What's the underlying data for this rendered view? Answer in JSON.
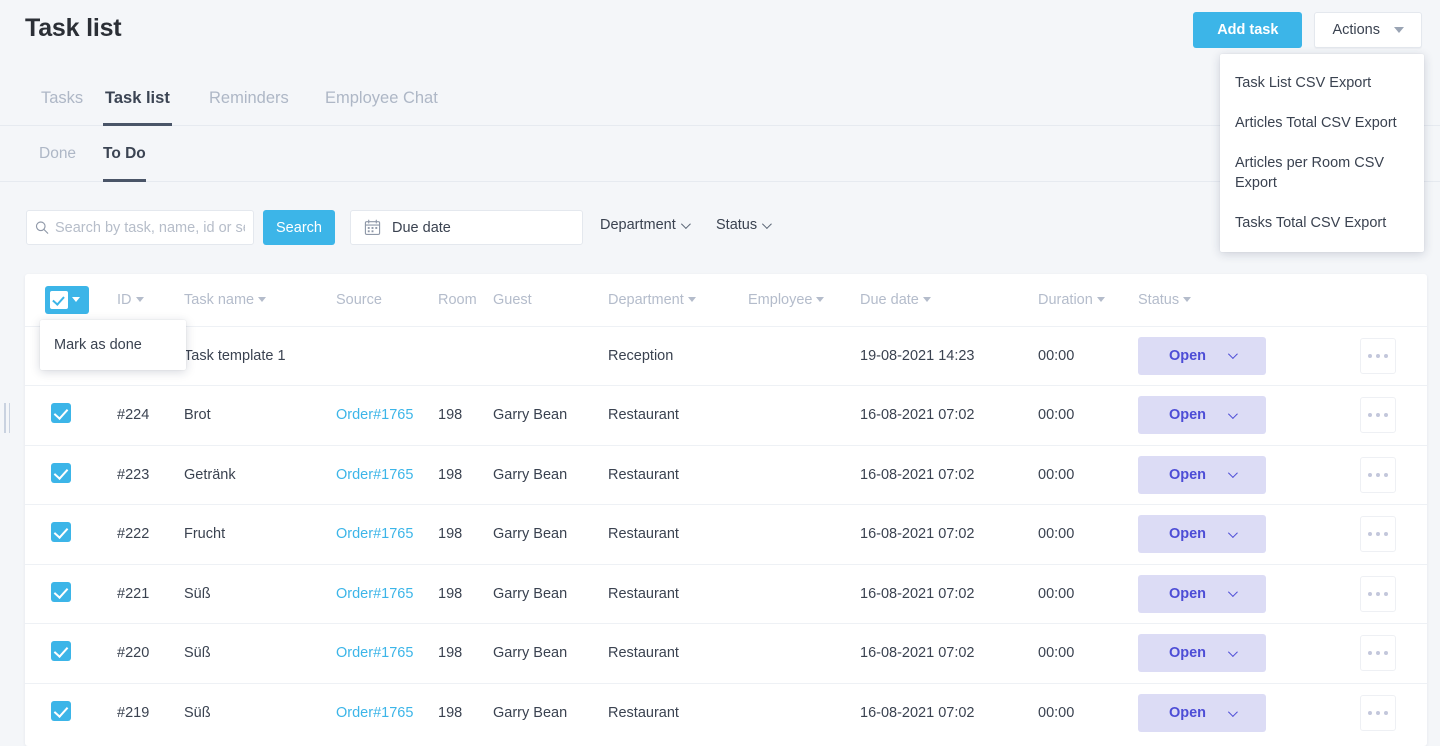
{
  "header": {
    "title": "Task list",
    "add_task_label": "Add task",
    "actions_label": "Actions"
  },
  "actions_menu": {
    "items": [
      {
        "label": "Task List CSV Export"
      },
      {
        "label": "Articles Total CSV Export"
      },
      {
        "label": "Articles per Room CSV Export"
      },
      {
        "label": "Tasks Total CSV Export"
      }
    ]
  },
  "tabs": [
    {
      "label": "Tasks",
      "active": false
    },
    {
      "label": "Task list",
      "active": true
    },
    {
      "label": "Reminders",
      "active": false
    },
    {
      "label": "Employee Chat",
      "active": false
    }
  ],
  "subtabs": [
    {
      "label": "Done",
      "active": false
    },
    {
      "label": "To Do",
      "active": true
    }
  ],
  "filters": {
    "search_placeholder": "Search by task, name, id or se",
    "search_value": "",
    "search_button": "Search",
    "due_date_label": "Due date",
    "department_label": "Department",
    "status_label": "Status"
  },
  "bulk_menu": {
    "items": [
      {
        "label": "Mark as done"
      }
    ]
  },
  "table": {
    "columns": [
      {
        "label": "",
        "sortable": false
      },
      {
        "label": "ID",
        "sortable": true
      },
      {
        "label": "Task name",
        "sortable": true
      },
      {
        "label": "Source",
        "sortable": false
      },
      {
        "label": "Room",
        "sortable": false
      },
      {
        "label": "Guest",
        "sortable": false
      },
      {
        "label": "Department",
        "sortable": true
      },
      {
        "label": "Employee",
        "sortable": true
      },
      {
        "label": "Due date",
        "sortable": true
      },
      {
        "label": "Duration",
        "sortable": true
      },
      {
        "label": "Status",
        "sortable": true
      },
      {
        "label": "",
        "sortable": false
      }
    ],
    "rows": [
      {
        "checked": true,
        "id": "",
        "task_name": "Task template 1",
        "source": "",
        "room": "",
        "guest": "",
        "department": "Reception",
        "employee": "",
        "due_date": "19-08-2021 14:23",
        "duration": "00:00",
        "status": "Open"
      },
      {
        "checked": true,
        "id": "#224",
        "task_name": "Brot",
        "source": "Order#1765",
        "room": "198",
        "guest": "Garry Bean",
        "department": "Restaurant",
        "employee": "",
        "due_date": "16-08-2021 07:02",
        "duration": "00:00",
        "status": "Open"
      },
      {
        "checked": true,
        "id": "#223",
        "task_name": "Getränk",
        "source": "Order#1765",
        "room": "198",
        "guest": "Garry Bean",
        "department": "Restaurant",
        "employee": "",
        "due_date": "16-08-2021 07:02",
        "duration": "00:00",
        "status": "Open"
      },
      {
        "checked": true,
        "id": "#222",
        "task_name": "Frucht",
        "source": "Order#1765",
        "room": "198",
        "guest": "Garry Bean",
        "department": "Restaurant",
        "employee": "",
        "due_date": "16-08-2021 07:02",
        "duration": "00:00",
        "status": "Open"
      },
      {
        "checked": true,
        "id": "#221",
        "task_name": "Süß",
        "source": "Order#1765",
        "room": "198",
        "guest": "Garry Bean",
        "department": "Restaurant",
        "employee": "",
        "due_date": "16-08-2021 07:02",
        "duration": "00:00",
        "status": "Open"
      },
      {
        "checked": true,
        "id": "#220",
        "task_name": "Süß",
        "source": "Order#1765",
        "room": "198",
        "guest": "Garry Bean",
        "department": "Restaurant",
        "employee": "",
        "due_date": "16-08-2021 07:02",
        "duration": "00:00",
        "status": "Open"
      },
      {
        "checked": true,
        "id": "#219",
        "task_name": "Süß",
        "source": "Order#1765",
        "room": "198",
        "guest": "Garry Bean",
        "department": "Restaurant",
        "employee": "",
        "due_date": "16-08-2021 07:02",
        "duration": "00:00",
        "status": "Open"
      }
    ]
  },
  "colors": {
    "accent": "#3cb5e8",
    "page_bg": "#f4f6f9",
    "status_badge_bg": "#dcdcf5",
    "status_badge_text": "#4d4dd6",
    "muted_text": "#b4bccb"
  }
}
